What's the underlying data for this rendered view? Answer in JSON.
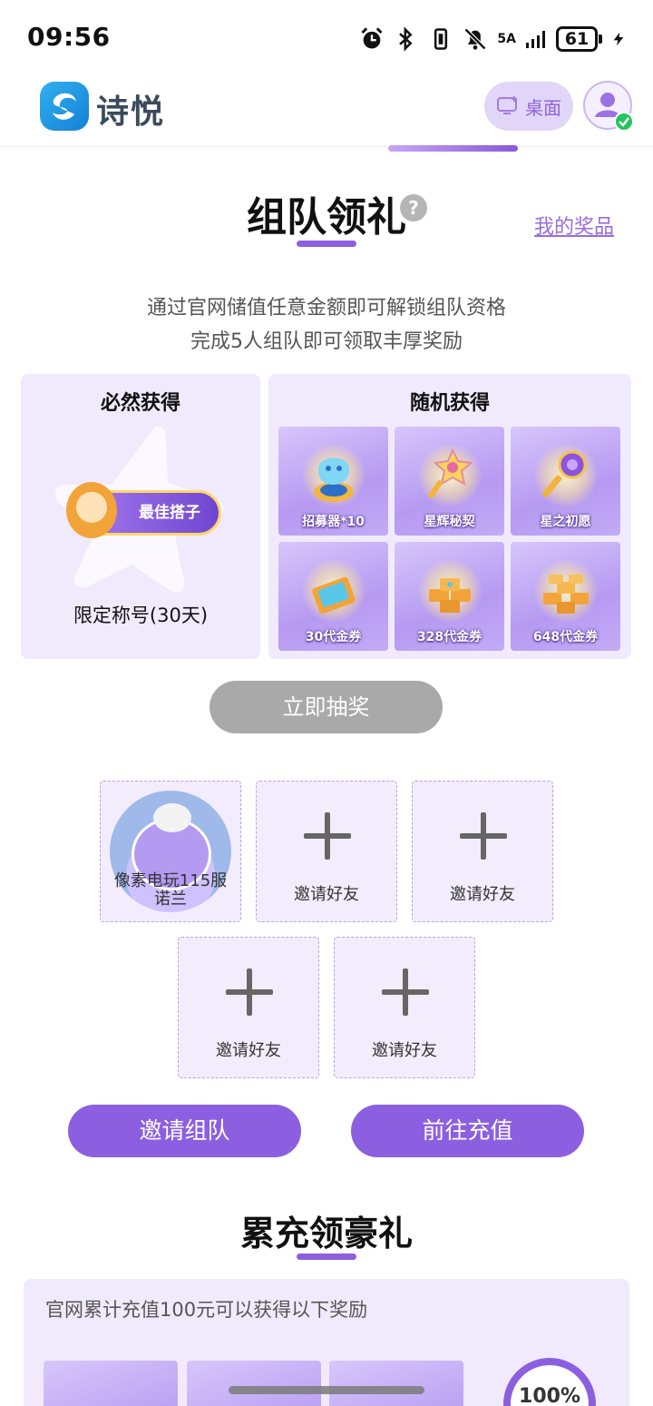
{
  "status_bar": {
    "time": "09:56",
    "network": "5A",
    "battery": "61",
    "icons": [
      "alarm-icon",
      "bluetooth-icon",
      "vibrate-icon",
      "mute-icon",
      "signal-icon",
      "battery-icon",
      "charging-icon"
    ]
  },
  "header": {
    "logo_text": "诗悦",
    "desktop_label": "桌面",
    "accent_color": "#8c5fe0"
  },
  "team_gift": {
    "title": "组队领礼",
    "help": "?",
    "my_prizes": "我的奖品",
    "desc_line1": "通过官网储值任意金额即可解锁组队资格",
    "desc_line2": "完成5人组队即可领取丰厚奖励",
    "guaranteed": {
      "title": "必然获得",
      "badge_text": "最佳搭子",
      "label": "限定称号(30天)"
    },
    "random": {
      "title": "随机获得",
      "prizes": [
        "招募器*10",
        "星辉秘契",
        "星之初愿",
        "30代金券",
        "328代金券",
        "648代金券"
      ]
    },
    "draw_button": "立即抽奖",
    "team": {
      "member_name_line1": "像素电玩115服",
      "member_name_line2": "诺兰",
      "invite_label": "邀请好友"
    },
    "invite_team_button": "邀请组队",
    "recharge_button": "前往充值"
  },
  "accumulate": {
    "title": "累充领豪礼",
    "desc": "官网累计充值100元可以获得以下奖励",
    "progress": "100%"
  }
}
